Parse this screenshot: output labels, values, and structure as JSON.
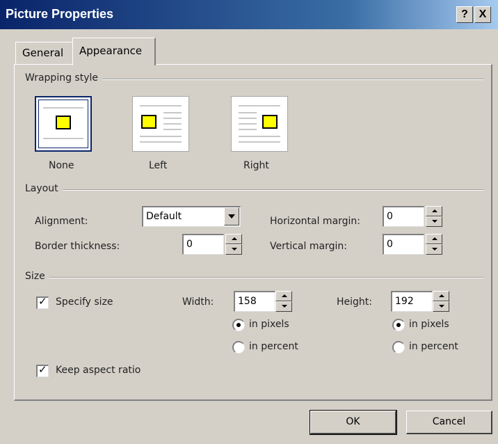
{
  "window": {
    "title": "Picture Properties",
    "help_glyph": "?",
    "close_glyph": "X"
  },
  "tabs": [
    {
      "label": "General",
      "active": false
    },
    {
      "label": "Appearance",
      "active": true
    }
  ],
  "wrapping_style": {
    "title": "Wrapping style",
    "options": [
      {
        "label": "None",
        "selected": true
      },
      {
        "label": "Left",
        "selected": false
      },
      {
        "label": "Right",
        "selected": false
      }
    ]
  },
  "layout": {
    "title": "Layout",
    "alignment_label": "Alignment:",
    "alignment_value": "Default",
    "border_label": "Border thickness:",
    "border_value": "0",
    "hmargin_label": "Horizontal margin:",
    "hmargin_value": "0",
    "vmargin_label": "Vertical margin:",
    "vmargin_value": "0"
  },
  "size": {
    "title": "Size",
    "specify_label": "Specify size",
    "specify_checked": true,
    "width_label": "Width:",
    "width_value": "158",
    "height_label": "Height:",
    "height_value": "192",
    "in_pixels": "in pixels",
    "in_percent": "in percent",
    "width_unit": "pixels",
    "height_unit": "pixels",
    "keep_aspect_label": "Keep aspect ratio",
    "keep_aspect_checked": true
  },
  "buttons": {
    "ok": "OK",
    "cancel": "Cancel"
  },
  "colors": {
    "title_start": "#0a246a",
    "title_end": "#a6caf0",
    "face": "#d4d0c8",
    "picture": "#ffff00"
  }
}
